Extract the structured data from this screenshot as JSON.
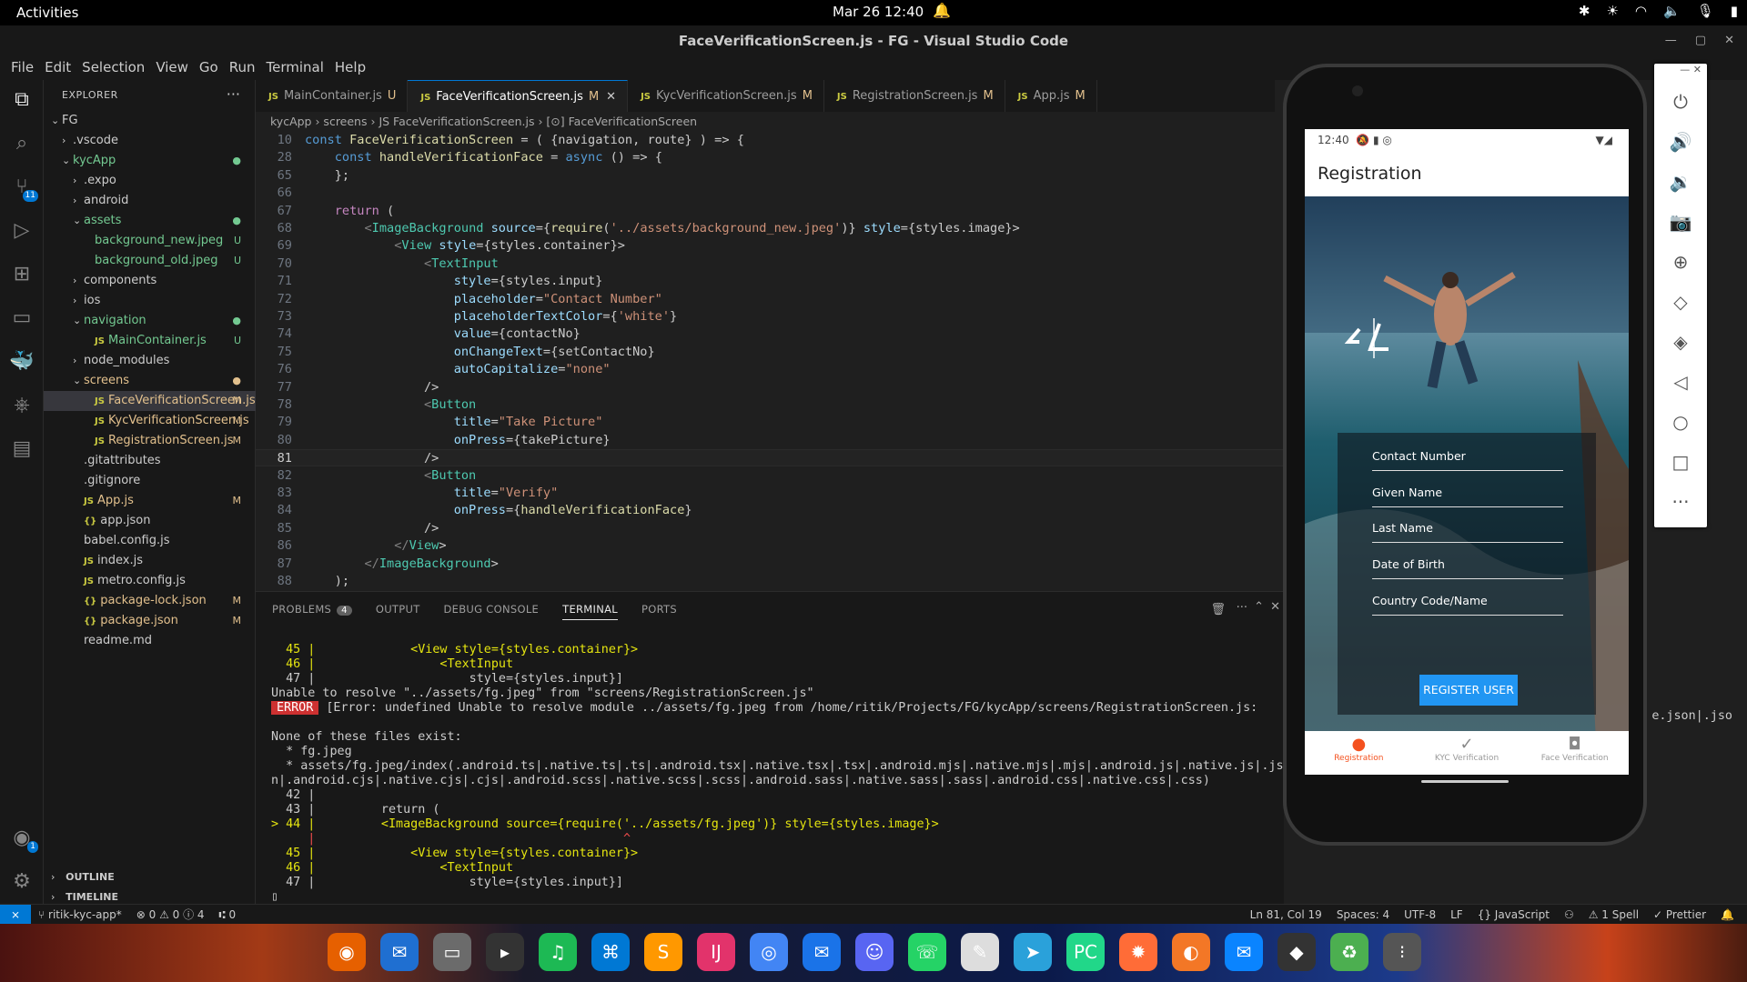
{
  "system": {
    "activities": "Activities",
    "clock": "Mar 26  12:40"
  },
  "window": {
    "title": "FaceVerificationScreen.js - FG - Visual Studio Code"
  },
  "menu": [
    "File",
    "Edit",
    "Selection",
    "View",
    "Go",
    "Run",
    "Terminal",
    "Help"
  ],
  "activity_badges": {
    "source_control": "11",
    "accounts": "1"
  },
  "explorer": {
    "header": "EXPLORER",
    "items": [
      {
        "label": "FG",
        "indent": 0,
        "chev": "⌄",
        "color": "",
        "status": ""
      },
      {
        "label": ".vscode",
        "indent": 1,
        "chev": "›",
        "color": "",
        "status": ""
      },
      {
        "label": "kycApp",
        "indent": 1,
        "chev": "⌄",
        "color": "green",
        "status": "●"
      },
      {
        "label": ".expo",
        "indent": 2,
        "chev": "›",
        "color": "",
        "status": ""
      },
      {
        "label": "android",
        "indent": 2,
        "chev": "›",
        "color": "",
        "status": ""
      },
      {
        "label": "assets",
        "indent": 2,
        "chev": "⌄",
        "color": "green",
        "status": "●"
      },
      {
        "label": "background_new.jpeg",
        "indent": 3,
        "chev": "",
        "color": "green",
        "status": "U"
      },
      {
        "label": "background_old.jpeg",
        "indent": 3,
        "chev": "",
        "color": "green",
        "status": "U"
      },
      {
        "label": "components",
        "indent": 2,
        "chev": "›",
        "color": "",
        "status": ""
      },
      {
        "label": "ios",
        "indent": 2,
        "chev": "›",
        "color": "",
        "status": ""
      },
      {
        "label": "navigation",
        "indent": 2,
        "chev": "⌄",
        "color": "green",
        "status": "●"
      },
      {
        "label": "MainContainer.js",
        "indent": 3,
        "chev": "",
        "color": "green",
        "status": "U",
        "js": "JS"
      },
      {
        "label": "node_modules",
        "indent": 2,
        "chev": "›",
        "color": "",
        "status": ""
      },
      {
        "label": "screens",
        "indent": 2,
        "chev": "⌄",
        "color": "yellow",
        "status": "●"
      },
      {
        "label": "FaceVerificationScreen.js",
        "indent": 3,
        "chev": "",
        "color": "yellow",
        "status": "M",
        "js": "JS",
        "sel": true
      },
      {
        "label": "KycVerificationScreen.js",
        "indent": 3,
        "chev": "",
        "color": "yellow",
        "status": "M",
        "js": "JS"
      },
      {
        "label": "RegistrationScreen.js",
        "indent": 3,
        "chev": "",
        "color": "yellow",
        "status": "M",
        "js": "JS"
      },
      {
        "label": ".gitattributes",
        "indent": 2,
        "chev": "",
        "color": "",
        "status": ""
      },
      {
        "label": ".gitignore",
        "indent": 2,
        "chev": "",
        "color": "",
        "status": ""
      },
      {
        "label": "App.js",
        "indent": 2,
        "chev": "",
        "color": "yellow",
        "status": "M",
        "js": "JS"
      },
      {
        "label": "app.json",
        "indent": 2,
        "chev": "",
        "color": "",
        "status": "",
        "js": "{}"
      },
      {
        "label": "babel.config.js",
        "indent": 2,
        "chev": "",
        "color": "",
        "status": ""
      },
      {
        "label": "index.js",
        "indent": 2,
        "chev": "",
        "color": "",
        "status": "",
        "js": "JS"
      },
      {
        "label": "metro.config.js",
        "indent": 2,
        "chev": "",
        "color": "",
        "status": "",
        "js": "JS"
      },
      {
        "label": "package-lock.json",
        "indent": 2,
        "chev": "",
        "color": "yellow",
        "status": "M",
        "js": "{}"
      },
      {
        "label": "package.json",
        "indent": 2,
        "chev": "",
        "color": "yellow",
        "status": "M",
        "js": "{}"
      },
      {
        "label": "readme.md",
        "indent": 2,
        "chev": "",
        "color": "",
        "status": ""
      }
    ],
    "outline": "OUTLINE",
    "timeline": "TIMELINE"
  },
  "tabs": [
    {
      "label": "MainContainer.js",
      "mark": "U",
      "active": false
    },
    {
      "label": "FaceVerificationScreen.js",
      "mark": "M",
      "active": true
    },
    {
      "label": "KycVerificationScreen.js",
      "mark": "M",
      "active": false
    },
    {
      "label": "RegistrationScreen.js",
      "mark": "M",
      "active": false
    },
    {
      "label": "App.js",
      "mark": "M",
      "active": false
    }
  ],
  "breadcrumb": "kycApp  ›  screens  ›  JS FaceVerificationScreen.js  ›  [⊙] FaceVerificationScreen",
  "code": [
    {
      "n": "10",
      "t": "const FaceVerificationScreen = ( {navigation, route} ) => {"
    },
    {
      "n": "28",
      "t": "    const handleVerificationFace = async () => {"
    },
    {
      "n": "65",
      "t": "    };"
    },
    {
      "n": "66",
      "t": ""
    },
    {
      "n": "67",
      "t": "    return ("
    },
    {
      "n": "68",
      "t": "        <ImageBackground source={require('../assets/background_new.jpeg')} style={styles.image}>"
    },
    {
      "n": "69",
      "t": "            <View style={styles.container}>"
    },
    {
      "n": "70",
      "t": "                <TextInput"
    },
    {
      "n": "71",
      "t": "                    style={styles.input}"
    },
    {
      "n": "72",
      "t": "                    placeholder=\"Contact Number\""
    },
    {
      "n": "73",
      "t": "                    placeholderTextColor={'white'}"
    },
    {
      "n": "74",
      "t": "                    value={contactNo}"
    },
    {
      "n": "75",
      "t": "                    onChangeText={setContactNo}"
    },
    {
      "n": "76",
      "t": "                    autoCapitalize=\"none\""
    },
    {
      "n": "77",
      "t": "                />"
    },
    {
      "n": "78",
      "t": "                <Button"
    },
    {
      "n": "79",
      "t": "                    title=\"Take Picture\""
    },
    {
      "n": "80",
      "t": "                    onPress={takePicture}"
    },
    {
      "n": "81",
      "t": "                />"
    },
    {
      "n": "82",
      "t": "                <Button"
    },
    {
      "n": "83",
      "t": "                    title=\"Verify\""
    },
    {
      "n": "84",
      "t": "                    onPress={handleVerificationFace}"
    },
    {
      "n": "85",
      "t": "                />"
    },
    {
      "n": "86",
      "t": "            </View>"
    },
    {
      "n": "87",
      "t": "        </ImageBackground>"
    },
    {
      "n": "88",
      "t": "    );"
    }
  ],
  "panel": {
    "tabs": [
      "PROBLEMS",
      "OUTPUT",
      "DEBUG CONSOLE",
      "TERMINAL",
      "PORTS"
    ],
    "problems_count": "4",
    "active": "TERMINAL"
  },
  "terminal": [
    "  45 |             <View style={styles.container}>",
    "  46 |                 <TextInput",
    "  47 |                     style={styles.input}]",
    "Unable to resolve \"../assets/fg.jpeg\" from \"screens/RegistrationScreen.js\"",
    "[Error: undefined Unable to resolve module ../assets/fg.jpeg from /home/ritik/Projects/FG/kycApp/screens/RegistrationScreen.js:",
    "",
    "None of these files exist:",
    "  * fg.jpeg",
    "  * assets/fg.jpeg/index(.android.ts|.native.ts|.ts|.android.tsx|.native.tsx|.tsx|.android.mjs|.native.mjs|.mjs|.android.js|.native.js|.js|",
    "n|.android.cjs|.native.cjs|.cjs|.android.scss|.native.scss|.scss|.android.sass|.native.sass|.sass|.android.css|.native.css|.css)",
    "  42 |",
    "  43 |         return (",
    "> 44 |         <ImageBackground source={require('../assets/fg.jpeg')} style={styles.image}>",
    "     |                                          ^",
    "  45 |             <View style={styles.container}>",
    "  46 |                 <TextInput",
    "  47 |                     style={styles.input}]"
  ],
  "terminal_overflow": "e.json|.jso",
  "error_label": "ERROR",
  "status": {
    "branch": "ritik-kyc-app*",
    "errors": "⊗ 0 ⚠ 0 ⓘ 4",
    "ports": "⑆ 0",
    "position": "Ln 81, Col 19",
    "spaces": "Spaces: 4",
    "encoding": "UTF-8",
    "eol": "LF",
    "lang": "{} JavaScript",
    "spell": "⚠ 1 Spell",
    "prettier": "✓ Prettier"
  },
  "phone": {
    "time": "12:40",
    "app_title": "Registration",
    "fields": [
      "Contact Number",
      "Given Name",
      "Last Name",
      "Date of Birth",
      "Country Code/Name"
    ],
    "button": "REGISTER USER",
    "nav": [
      "Registration",
      "KYC Verification",
      "Face Verification"
    ]
  },
  "dock_apps": [
    "firefox",
    "thunderbird",
    "files",
    "terminal",
    "spotify",
    "vscode",
    "sublime",
    "intellij",
    "chrome",
    "mail",
    "discord",
    "whatsapp",
    "editor",
    "telegram",
    "pycharm",
    "postman",
    "jupyter",
    "chat",
    "db",
    "trash",
    "grid"
  ]
}
